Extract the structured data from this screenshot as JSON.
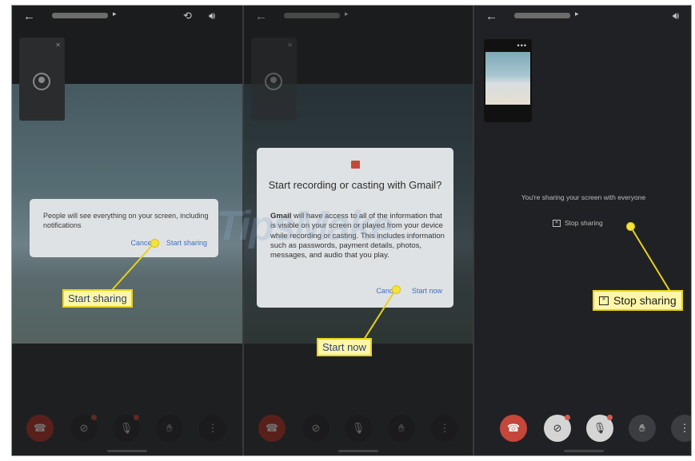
{
  "panel1": {
    "dialog_message": "People will see everything on your screen, including notifications",
    "cancel_label": "Cancel",
    "start_label": "Start sharing"
  },
  "panel2": {
    "dialog_title": "Start recording or casting with Gmail?",
    "dialog_app": "Gmail",
    "dialog_body": " will have access to all of the information that is visible on your screen or played from your device while recording or casting. This includes information such as passwords, payment details, photos, messages, and audio that you play.",
    "cancel_label": "Cancel",
    "start_label": "Start now"
  },
  "panel3": {
    "sharing_message": "You're sharing your screen with everyone",
    "stop_label": "Stop sharing"
  },
  "callouts": {
    "start_sharing": "Start sharing",
    "start_now": "Start now",
    "stop_sharing": "Stop sharing"
  },
  "watermark": {
    "text": "TipsMake",
    "suffix": ".com"
  },
  "icons": {
    "back": "back-arrow-icon",
    "camera_switch": "camera-switch-icon",
    "speaker": "speaker-icon",
    "end_call": "end-call-icon",
    "camera_off": "camera-off-icon",
    "mic_off": "mic-off-icon",
    "raise_hand": "raise-hand-icon",
    "more": "more-vertical-icon"
  },
  "colors": {
    "callout_fill": "#fff6a8",
    "callout_border": "#e8d21a",
    "end_call": "#c5463b",
    "link_blue": "#3e6fc2"
  }
}
